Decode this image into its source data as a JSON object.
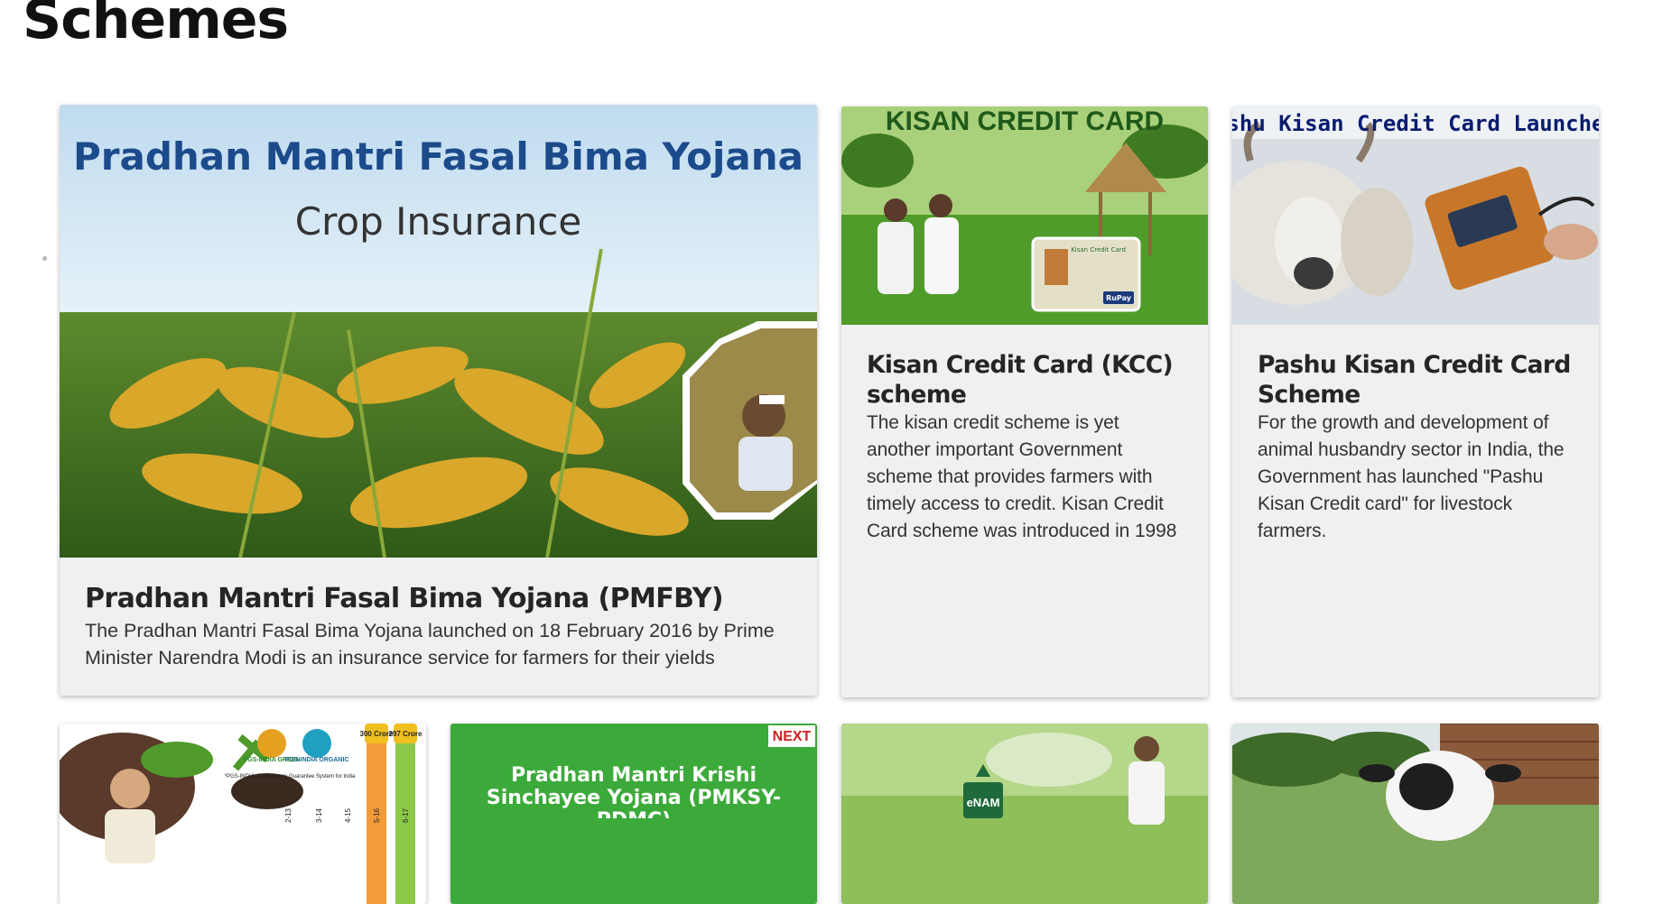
{
  "page": {
    "title": "Schemes"
  },
  "cards": {
    "pmfby": {
      "image_heading": "Pradhan Mantri Fasal Bima Yojana",
      "image_subheading": "Crop Insurance",
      "title": "Pradhan Mantri Fasal Bima Yojana (PMFBY)",
      "description": "The Pradhan Mantri Fasal Bima Yojana launched on 18 February 2016 by Prime Minister Narendra Modi is an insurance service for farmers for their yields"
    },
    "kcc": {
      "image_heading": "KISAN CREDIT CARD",
      "card_label": "Kisan Credit Card",
      "card_brand": "RuPay",
      "title": "Kisan Credit Card (KCC) scheme",
      "description": "The kisan credit scheme is yet another important Government scheme that provides farmers with timely access to credit. Kisan Credit Card scheme was introduced in 1998"
    },
    "pkcc": {
      "image_heading": "ashu Kisan Credit Card Launched",
      "title": "Pashu Kisan Credit Card Scheme",
      "description": "For the growth and development of animal husbandry sector in India, the Government has launched \"Pashu Kisan Credit card\" for livestock farmers."
    },
    "pgs": {
      "logo_green": "PGS-INDIA GREEN",
      "logo_organic": "PGS-INDIA ORGANIC",
      "caption": "*PGS-INDIA: Participatory Guarantee System for India",
      "bar_labels": [
        "300 Crore",
        "297 Crore"
      ],
      "years": [
        "2-13",
        "3-14",
        "4-15",
        "5-16",
        "6-17"
      ]
    },
    "pmksy": {
      "image_heading": "Pradhan Mantri Krishi Sinchayee Yojana (PMKSY- PDMC)",
      "badge": "NEXT"
    },
    "enam": {
      "logo": "eNAM"
    },
    "dairy": {}
  },
  "colors": {
    "pmfby_heading": "#1c4b8c",
    "kcc_heading": "#1f5a1a",
    "pkcc_heading": "#0a1c6e",
    "card_bg": "#f0f0f0"
  }
}
